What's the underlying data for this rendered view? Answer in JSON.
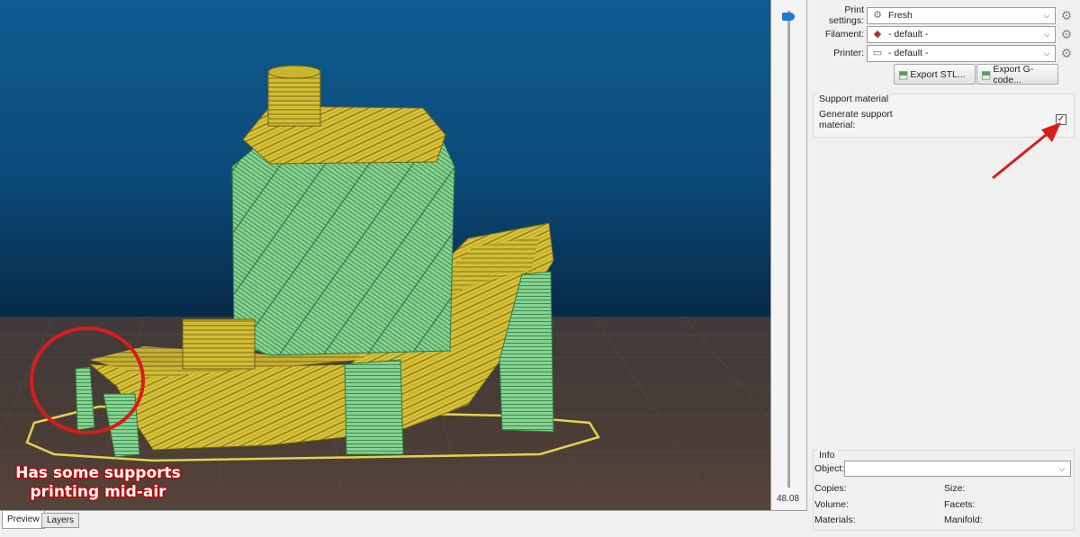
{
  "viewport": {
    "annotation": "Has some supports printing mid-air",
    "layer_value": "48.08",
    "colors": {
      "model": "#d8c23a",
      "support": "#7fd08a",
      "sky": "#0b4a78",
      "floor": "#4a3d36",
      "annotation": "#d81c1c"
    }
  },
  "tabs": [
    {
      "label": "Preview"
    },
    {
      "label": "Layers"
    }
  ],
  "settings": {
    "print": {
      "label": "Print settings:",
      "value": "Fresh",
      "icon": "gear-icon"
    },
    "filament": {
      "label": "Filament:",
      "value": "- default -",
      "icon": "filament-icon"
    },
    "printer": {
      "label": "Printer:",
      "value": "- default -",
      "icon": "printer-icon"
    }
  },
  "buttons": {
    "export_stl": "Export STL...",
    "export_gcode": "Export G-code..."
  },
  "support": {
    "title": "Support material",
    "generate_label_1": "Generate support",
    "generate_label_2": "material:",
    "generate_checked": true,
    "check_mark": "✓"
  },
  "info": {
    "title": "Info",
    "object_label": "Object:",
    "object_value": "",
    "copies_label": "Copies:",
    "size_label": "Size:",
    "volume_label": "Volume:",
    "facets_label": "Facets:",
    "materials_label": "Materials:",
    "manifold_label": "Manifold:"
  }
}
